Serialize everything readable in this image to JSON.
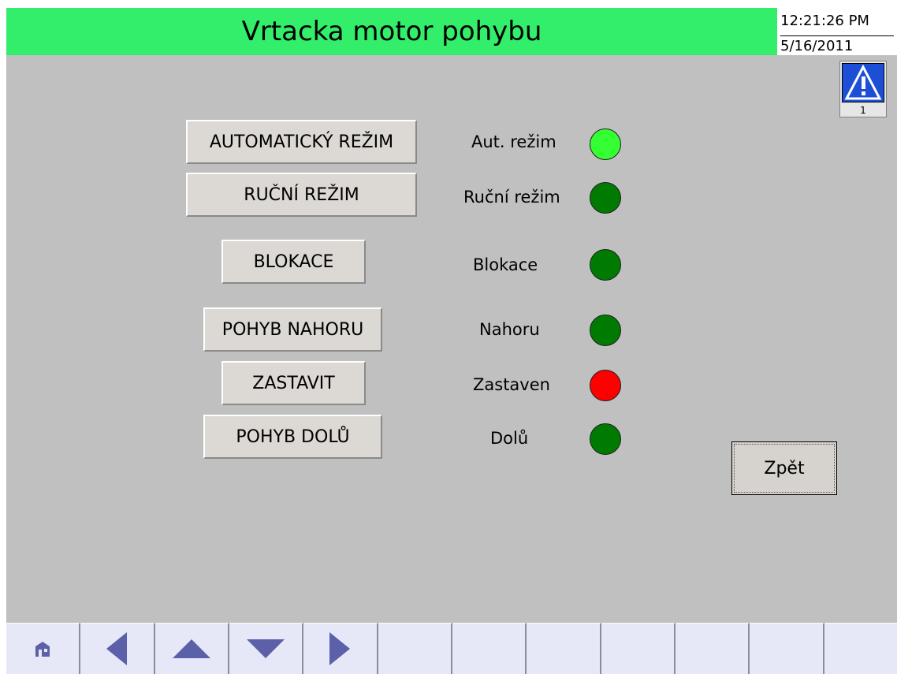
{
  "header": {
    "title": "Vrtacka motor pohybu",
    "time": "12:21:26 PM",
    "date": "5/16/2011"
  },
  "alarm": {
    "icon": "warning-icon",
    "count": "1"
  },
  "controls": [
    {
      "button": "AUTOMATICKÝ REŽIM",
      "label": "Aut. režim",
      "lamp_color": "#33ff33"
    },
    {
      "button": "RUČNÍ REŽIM",
      "label": "Ruční režim",
      "lamp_color": "#007a00"
    },
    {
      "button": "BLOKACE",
      "label": "Blokace",
      "lamp_color": "#007a00"
    },
    {
      "button": "POHYB NAHORU",
      "label": "Nahoru",
      "lamp_color": "#007a00"
    },
    {
      "button": "ZASTAVIT",
      "label": "Zastaven",
      "lamp_color": "#ff0000"
    },
    {
      "button": "POHYB DOLŮ",
      "label": "Dolů",
      "lamp_color": "#007a00"
    }
  ],
  "back_button": "Zpět",
  "navbar": {
    "keys": [
      "home-icon",
      "arrow-left-icon",
      "arrow-up-icon",
      "arrow-down-icon",
      "arrow-right-icon",
      "",
      "",
      "",
      "",
      "",
      "",
      ""
    ],
    "icon_color": "#5c60a8",
    "background": "#e6e8f8"
  },
  "colors": {
    "title_bar": "#33ee6a",
    "screen_background": "#c0c0c0"
  }
}
